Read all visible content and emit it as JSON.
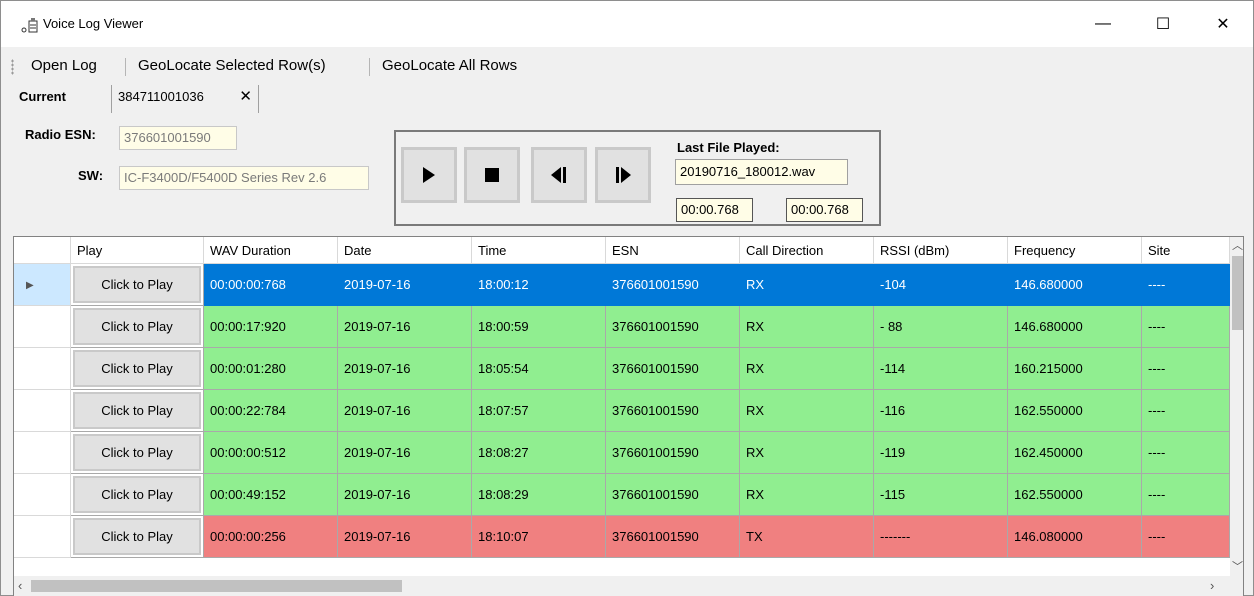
{
  "window": {
    "title": "Voice Log Viewer"
  },
  "window_controls": {
    "minimize": "—",
    "maximize": "☐",
    "close": "✕"
  },
  "menu": {
    "items": [
      "Open Log",
      "GeoLocate Selected Row(s)",
      "GeoLocate All Rows"
    ]
  },
  "tabs": [
    {
      "label": "Current",
      "active": true
    },
    {
      "label": "384711001036",
      "close": "✕"
    }
  ],
  "info": {
    "radio_esn_label": "Radio ESN:",
    "radio_esn_value": "376601001590",
    "sw_label": "SW:",
    "sw_value": "IC-F3400D/F5400D Series Rev 2.6"
  },
  "player": {
    "last_file_label": "Last File Played:",
    "last_file": "20190716_180012.wav",
    "time_position": "00:00.768",
    "time_total": "00:00.768",
    "buttons": [
      "play-icon",
      "stop-icon",
      "previous-icon",
      "next-icon"
    ]
  },
  "grid": {
    "columns": [
      "Play",
      "WAV Duration",
      "Date",
      "Time",
      "ESN",
      "Call Direction",
      "RSSI (dBm)",
      "Frequency",
      "Site"
    ],
    "play_label": "Click to Play",
    "colors": {
      "selected": "#0078d7",
      "rx": "#90ee90",
      "tx": "#f08080"
    },
    "rows": [
      {
        "duration": "00:00:00:768",
        "date": "2019-07-16",
        "time": "18:00:12",
        "esn": "376601001590",
        "direction": "RX",
        "rssi": "-104",
        "frequency": "146.680000",
        "site": "----",
        "state": "selected"
      },
      {
        "duration": "00:00:17:920",
        "date": "2019-07-16",
        "time": "18:00:59",
        "esn": "376601001590",
        "direction": "RX",
        "rssi": "- 88",
        "frequency": "146.680000",
        "site": "----",
        "state": "rx"
      },
      {
        "duration": "00:00:01:280",
        "date": "2019-07-16",
        "time": "18:05:54",
        "esn": "376601001590",
        "direction": "RX",
        "rssi": "-114",
        "frequency": "160.215000",
        "site": "----",
        "state": "rx"
      },
      {
        "duration": "00:00:22:784",
        "date": "2019-07-16",
        "time": "18:07:57",
        "esn": "376601001590",
        "direction": "RX",
        "rssi": "-116",
        "frequency": "162.550000",
        "site": "----",
        "state": "rx"
      },
      {
        "duration": "00:00:00:512",
        "date": "2019-07-16",
        "time": "18:08:27",
        "esn": "376601001590",
        "direction": "RX",
        "rssi": "-119",
        "frequency": "162.450000",
        "site": "----",
        "state": "rx"
      },
      {
        "duration": "00:00:49:152",
        "date": "2019-07-16",
        "time": "18:08:29",
        "esn": "376601001590",
        "direction": "RX",
        "rssi": "-115",
        "frequency": "162.550000",
        "site": "----",
        "state": "rx"
      },
      {
        "duration": "00:00:00:256",
        "date": "2019-07-16",
        "time": "18:10:07",
        "esn": "376601001590",
        "direction": "TX",
        "rssi": "-------",
        "frequency": "146.080000",
        "site": "----",
        "state": "tx"
      }
    ]
  }
}
